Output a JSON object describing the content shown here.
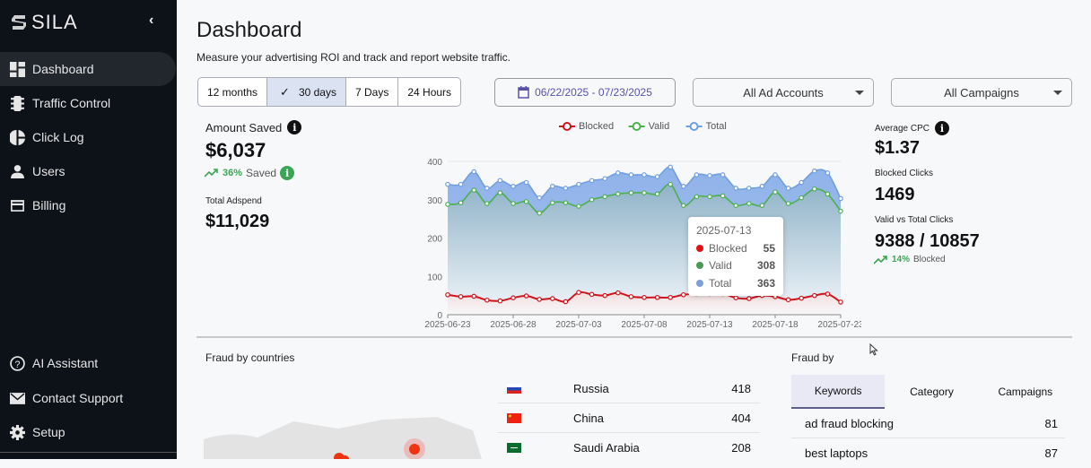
{
  "sidebar": {
    "brand": "SILA",
    "items": [
      {
        "label": "Dashboard",
        "icon": "dashboard-icon"
      },
      {
        "label": "Traffic Control",
        "icon": "traffic-light-icon"
      },
      {
        "label": "Click Log",
        "icon": "pie-chart-icon"
      },
      {
        "label": "Users",
        "icon": "user-icon"
      },
      {
        "label": "Billing",
        "icon": "credit-card-icon"
      }
    ],
    "bottom": [
      {
        "label": "AI Assistant",
        "icon": "help-circle-icon"
      },
      {
        "label": "Contact Support",
        "icon": "mail-icon"
      },
      {
        "label": "Setup",
        "icon": "gear-icon"
      }
    ]
  },
  "header": {
    "title": "Dashboard",
    "subtitle": "Measure your advertising ROI and track and report website traffic."
  },
  "filters": {
    "ranges": [
      "12 months",
      "30 days",
      "7 Days",
      "24 Hours"
    ],
    "selected_range": "30 days",
    "date_range": "06/22/2025 - 07/23/2025",
    "ad_accounts": "All Ad Accounts",
    "campaigns": "All Campaigns"
  },
  "stats": {
    "amount_saved_label": "Amount Saved",
    "amount_saved": "$6,037",
    "saved_pct": "36%",
    "saved_text": "Saved",
    "adspend_label": "Total Adspend",
    "adspend": "$11,029",
    "cpc_label": "Average CPC",
    "cpc": "$1.37",
    "blocked_label": "Blocked Clicks",
    "blocked": "1469",
    "valid_total_label": "Valid vs Total Clicks",
    "valid_total": "9388 / 10857",
    "blocked_pct": "14%",
    "blocked_text": "Blocked"
  },
  "colors": {
    "blocked": "#d0141e",
    "valid": "#4caf50",
    "total": "#6f9fe0",
    "accent": "#5552a8"
  },
  "chart_data": {
    "type": "line",
    "legend": "top",
    "ylim": [
      0,
      400
    ],
    "yticks": [
      0,
      100,
      200,
      300,
      400
    ],
    "xtick_labels": [
      "2025-06-23",
      "2025-06-28",
      "2025-07-03",
      "2025-07-08",
      "2025-07-13",
      "2025-07-18",
      "2025-07-23"
    ],
    "start": "2025-06-23",
    "series": [
      {
        "name": "Blocked",
        "values": [
          52,
          47,
          48,
          38,
          36,
          44,
          49,
          40,
          42,
          34,
          58,
          53,
          50,
          57,
          47,
          45,
          45,
          45,
          52,
          55,
          55,
          55,
          44,
          42,
          50,
          47,
          39,
          43,
          50,
          54,
          33
        ]
      },
      {
        "name": "Valid",
        "values": [
          288,
          292,
          325,
          290,
          318,
          290,
          295,
          265,
          292,
          292,
          283,
          300,
          308,
          315,
          318,
          318,
          315,
          340,
          285,
          308,
          308,
          310,
          285,
          290,
          285,
          320,
          290,
          305,
          328,
          315,
          270
        ]
      },
      {
        "name": "Total",
        "values": [
          340,
          340,
          373,
          330,
          350,
          335,
          345,
          305,
          335,
          330,
          340,
          350,
          355,
          370,
          365,
          365,
          360,
          385,
          335,
          365,
          363,
          365,
          330,
          330,
          335,
          365,
          330,
          345,
          375,
          370,
          303
        ]
      }
    ],
    "tooltip": {
      "date": "2025-07-13",
      "blocked": "55",
      "valid": "308",
      "total": "363"
    }
  },
  "fraud_countries": {
    "title": "Fraud by countries",
    "rows": [
      {
        "country": "Russia",
        "value": "418"
      },
      {
        "country": "China",
        "value": "404"
      },
      {
        "country": "Saudi Arabia",
        "value": "208"
      }
    ]
  },
  "fraud_by": {
    "title": "Fraud by",
    "tabs": [
      "Keywords",
      "Category",
      "Campaigns"
    ],
    "active": "Keywords",
    "rows": [
      {
        "keyword": "ad fraud blocking",
        "value": "81"
      },
      {
        "keyword": "best laptops",
        "value": "87"
      }
    ]
  }
}
